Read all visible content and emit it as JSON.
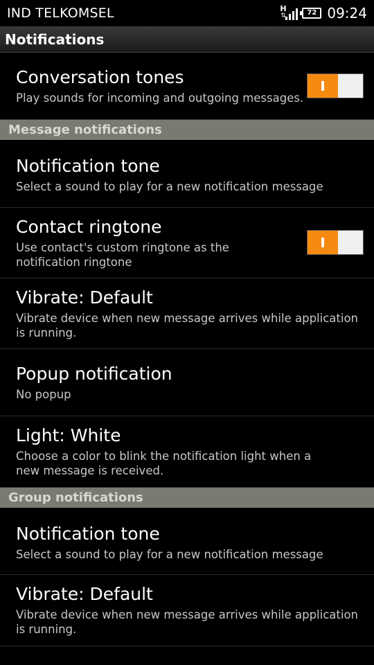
{
  "status": {
    "carrier": "IND TELKOMSEL",
    "network_type": "H",
    "battery": "72",
    "time": "09:24"
  },
  "title": "Notifications",
  "items": {
    "conversation_tones": {
      "title": "Conversation tones",
      "sub": "Play sounds for incoming and outgoing messages.",
      "enabled": true
    },
    "msg_section": "Message notifications",
    "msg_tone": {
      "title": "Notification tone",
      "sub": "Select a sound to play for a new notification message"
    },
    "contact_ringtone": {
      "title": "Contact ringtone",
      "sub": "Use contact's custom ringtone as the notification ringtone",
      "enabled": true
    },
    "msg_vibrate": {
      "title": "Vibrate: Default",
      "sub": "Vibrate device when new message arrives while application is running."
    },
    "popup": {
      "title": "Popup notification",
      "sub": "No popup"
    },
    "light": {
      "title": "Light: White",
      "sub": "Choose a color to blink the notification light when a new message is received."
    },
    "group_section": "Group notifications",
    "group_tone": {
      "title": "Notification tone",
      "sub": "Select a sound to play for a new notification message"
    },
    "group_vibrate": {
      "title": "Vibrate: Default",
      "sub": "Vibrate device when new message arrives while application is running."
    }
  },
  "colors": {
    "toggle_on": "#f58a10",
    "section_bg": "#7a7a70"
  }
}
